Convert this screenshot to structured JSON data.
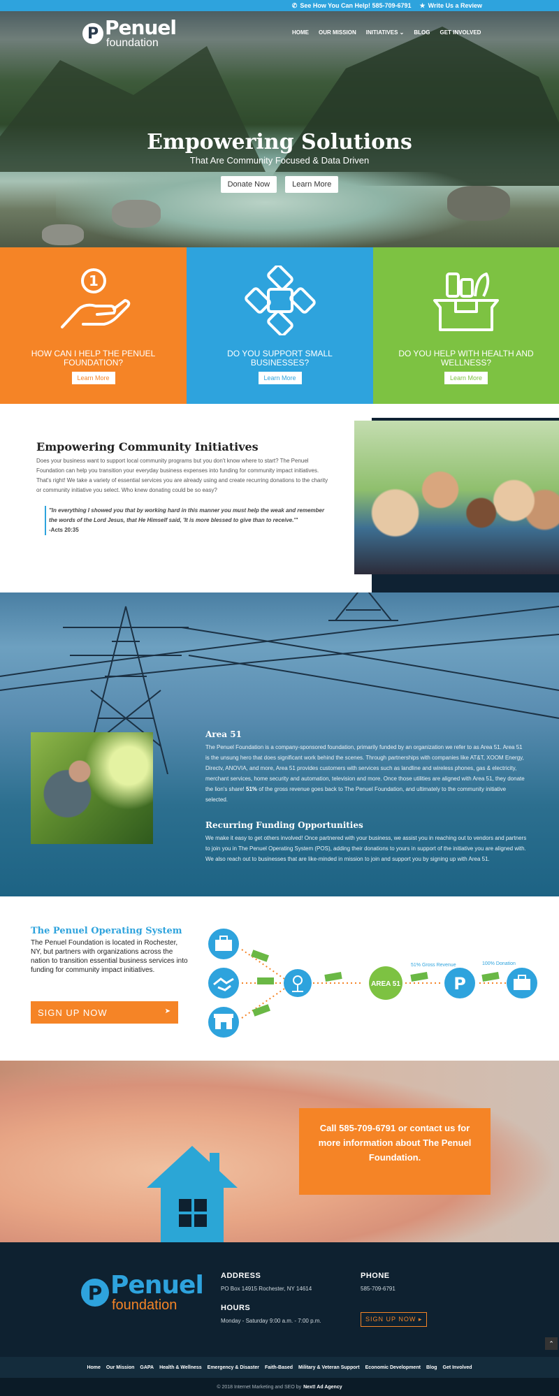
{
  "topbar": {
    "help": "See How You Can Help! 585-709-6791",
    "review": "Write Us a Review"
  },
  "brand": {
    "line1": "Penuel",
    "line2": "foundation",
    "mark": "P"
  },
  "nav": {
    "items": [
      "HOME",
      "OUR MISSION",
      "INITIATIVES",
      "BLOG",
      "GET INVOLVED"
    ]
  },
  "hero": {
    "title": "Empowering Solutions",
    "subtitle": "That Are Community Focused & Data Driven",
    "donate": "Donate Now",
    "learn": "Learn More"
  },
  "boxes": [
    {
      "title": "HOW CAN I HELP THE PENUEL FOUNDATION?",
      "button": "Learn More",
      "color": "#f58426",
      "icon": "hand-coin-icon"
    },
    {
      "title": "DO YOU SUPPORT SMALL BUSINESSES?",
      "button": "Learn More",
      "color": "#2ea3dd",
      "icon": "hands-circle-icon"
    },
    {
      "title": "DO YOU HELP WITH HEALTH AND WELLNESS?",
      "button": "Learn More",
      "color": "#7dc242",
      "icon": "grocery-box-icon"
    }
  ],
  "initiatives": {
    "title": "Empowering Community Initiatives",
    "body": "Does your business want to support local community programs but you don't know where to start? The Penuel Foundation can help you transition your everyday business expenses into funding for community impact initiatives. That's right! We take a variety of essential services you are already using and create recurring donations to the charity or community initiative you select. Who knew donating could be so easy?",
    "quote": "\"In everything I showed you that by working hard in this manner you must help the weak and remember the words of the Lord Jesus, that He Himself said, 'It is more blessed to give than to receive.'\"",
    "quote_ref": "-Acts 20:35"
  },
  "area51": {
    "title": "Area 51",
    "body_pre": "The Penuel Foundation is a company-sponsored foundation, primarily funded by an organization we refer to as Area 51. Area 51 is the unsung hero that does significant work behind the scenes. Through partnerships with companies like AT&T, XOOM Energy, Directv, ANOVIA, and more, Area 51 provides customers with services such as landline and wireless phones, gas & electricity, merchant services, home security and automation, television and more. Once those utilities are aligned with Area 51, they donate the lion's share! ",
    "body_bold": "51%",
    "body_post": " of the gross revenue goes back to The Penuel Foundation, and ultimately to the community initiative selected.",
    "title2": "Recurring Funding Opportunities",
    "body2": "We make it easy to get others involved! Once partnered with your business, we assist you in reaching out to vendors and partners to join you in The Penuel Operating System (POS), adding their donations to yours in support of the initiative you are aligned with. We also reach out to businesses that are like-minded in mission to join and support you by signing up with Area 51."
  },
  "pos": {
    "title": "The Penuel Operating System",
    "body": "The Penuel Foundation is located in Rochester, NY, but partners with organizations across the nation to transition essential business services into funding for community impact initiatives.",
    "signup": "SIGN UP NOW",
    "diagram": {
      "area51": "AREA 51",
      "gross": "51% Gross Revenue",
      "donation": "100% Donation"
    }
  },
  "call": {
    "text": "Call 585-709-6791 or contact us for more information about The Penuel Foundation."
  },
  "footer": {
    "address_label": "ADDRESS",
    "address": "PO Box 14915 Rochester, NY 14614",
    "hours_label": "HOURS",
    "hours": "Monday - Saturday 9:00 a.m. - 7:00 p.m.",
    "phone_label": "PHONE",
    "phone": "585-709-6791",
    "signup": "SIGN UP NOW",
    "nav": [
      "Home",
      "Our Mission",
      "GAPA",
      "Health & Wellness",
      "Emergency & Disaster",
      "Faith-Based",
      "Military & Veteran Support",
      "Economic Development",
      "Blog",
      "Get Involved"
    ],
    "copyright": "© 2018 Internet Marketing and SEO by",
    "agency": "Next! Ad Agency"
  }
}
